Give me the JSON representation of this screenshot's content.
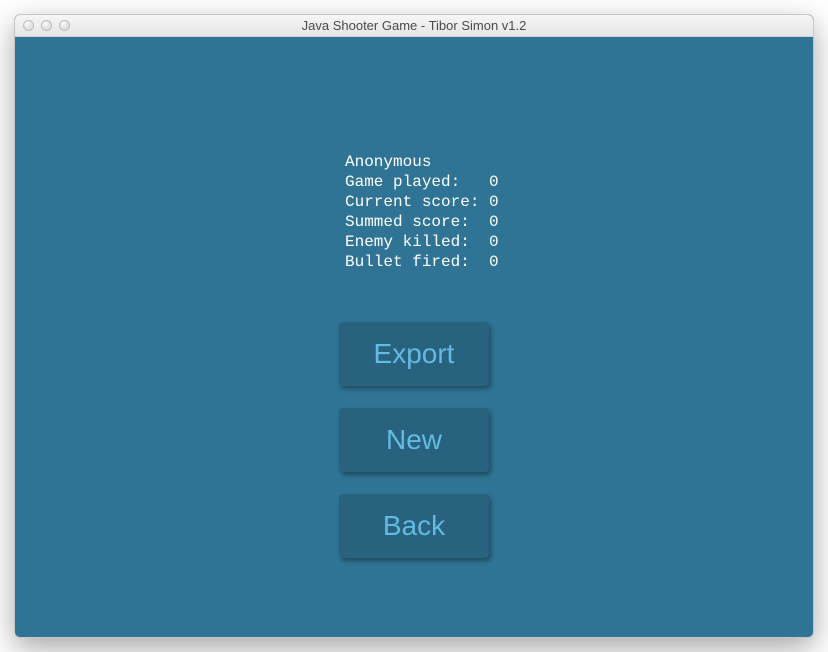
{
  "window": {
    "title": "Java Shooter Game - Tibor Simon v1.2"
  },
  "stats": {
    "player_name": "Anonymous",
    "lines": [
      {
        "label": "Game played",
        "value": 0
      },
      {
        "label": "Current score",
        "value": 0
      },
      {
        "label": "Summed score",
        "value": 0
      },
      {
        "label": "Enemy killed",
        "value": 0
      },
      {
        "label": "Bullet fired",
        "value": 0
      }
    ]
  },
  "buttons": {
    "export": "Export",
    "new": "New",
    "back": "Back"
  },
  "colors": {
    "bg": "#2f7494",
    "btn_bg": "#28627e",
    "btn_text": "#61bbe3",
    "text": "#ffffff"
  }
}
